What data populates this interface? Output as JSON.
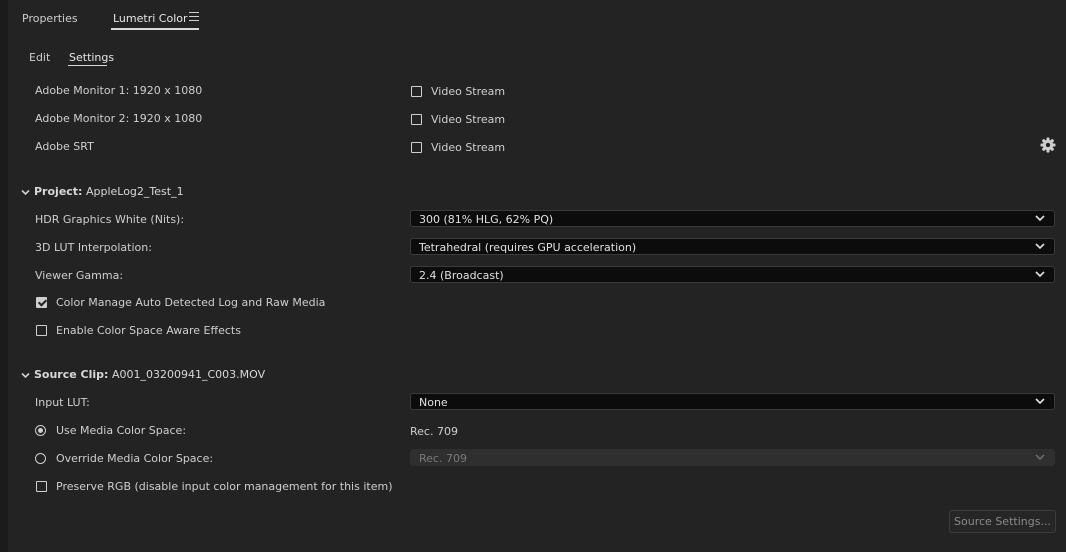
{
  "tabs": [
    {
      "label": "Properties"
    },
    {
      "label": "Lumetri Color"
    }
  ],
  "subtabs": [
    {
      "label": "Edit"
    },
    {
      "label": "Settings"
    }
  ],
  "monitors": [
    {
      "label": "Adobe Monitor 1: 1920 x 1080",
      "option": "Video Stream",
      "checked": false
    },
    {
      "label": "Adobe Monitor 2: 1920 x 1080",
      "option": "Video Stream",
      "checked": false
    },
    {
      "label": "Adobe SRT",
      "option": "Video Stream",
      "checked": false
    }
  ],
  "project": {
    "heading": "Project:",
    "name": "AppleLog2_Test_1",
    "hdr_label": "HDR Graphics White (Nits):",
    "hdr_value": "300 (81% HLG, 62% PQ)",
    "lut_label": "3D LUT Interpolation:",
    "lut_value": "Tetrahedral (requires GPU acceleration)",
    "gamma_label": "Viewer Gamma:",
    "gamma_value": "2.4 (Broadcast)",
    "auto_detect_label": "Color Manage Auto Detected Log and Raw Media",
    "auto_detect_checked": true,
    "space_aware_label": "Enable Color Space Aware Effects",
    "space_aware_checked": false
  },
  "source_clip": {
    "heading": "Source Clip:",
    "name": "A001_03200941_C003.MOV",
    "input_lut_label": "Input LUT:",
    "input_lut_value": "None",
    "use_media_label": "Use Media Color Space:",
    "use_media_value": "Rec. 709",
    "override_label": "Override Media Color Space:",
    "override_value": "Rec. 709",
    "preserve_label": "Preserve RGB (disable input color management for this item)",
    "source_settings_label": "Source Settings..."
  },
  "icons": {
    "menu": "hamburger-icon",
    "gear": "gear-icon",
    "chevron": "chevron-down-icon"
  },
  "colors": {
    "background": "#232323",
    "dropdown": "#0c0c0c",
    "text": "#cfcfcf"
  }
}
